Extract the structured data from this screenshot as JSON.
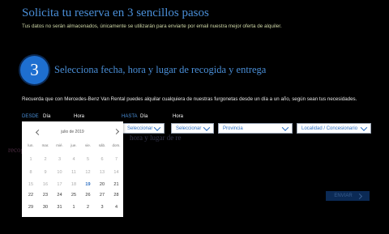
{
  "header": {
    "title": "Solicita tu reserva en 3 sencillos pasos",
    "subtitle": "Tus datos no serán almacenados, únicamente se utilizarán para enviarte por email nuestra mejor oferta de alquiler."
  },
  "step": {
    "number": "3",
    "title": "Selecciona fecha, hora y lugar de recogida y entrega"
  },
  "hint": "Recuerda que con Mercedes-Benz Van Rental puedes alquilar cualquiera de nuestras furgonetas desde un día a un año, según sean tus necesidades.",
  "labels": {
    "desde": "DESDE",
    "dia1": "Día",
    "hora1": "Hora",
    "hasta": "HASTA",
    "dia2": "Día",
    "hora2": "Hora"
  },
  "selects": {
    "hasta_dia": "Seleccionar",
    "hasta_hora": "Seleccionar",
    "provincia": "Provincia",
    "localidad": "Localidad / Concesionario"
  },
  "background_text": {
    "left": "recogida y entrega",
    "mid": "hora y lugar de re"
  },
  "calendar": {
    "month": "julio de 2019",
    "weekdays": [
      "lun.",
      "mar.",
      "mié.",
      "jue.",
      "vie.",
      "sáb.",
      "dom."
    ],
    "today": "19",
    "weeks": [
      [
        "1",
        "2",
        "3",
        "4",
        "5",
        "6",
        "7"
      ],
      [
        "8",
        "9",
        "10",
        "11",
        "12",
        "13",
        "14"
      ],
      [
        "15",
        "16",
        "17",
        "18",
        "19",
        "20",
        "21"
      ],
      [
        "22",
        "23",
        "24",
        "25",
        "26",
        "27",
        "28"
      ],
      [
        "29",
        "30",
        "31",
        "1",
        "2",
        "3",
        "4"
      ]
    ]
  },
  "submit_label": "ENVIAR",
  "colors": {
    "accent": "#4a8fd8",
    "circle": "#1e6fd0",
    "link": "#2c6fc2"
  }
}
